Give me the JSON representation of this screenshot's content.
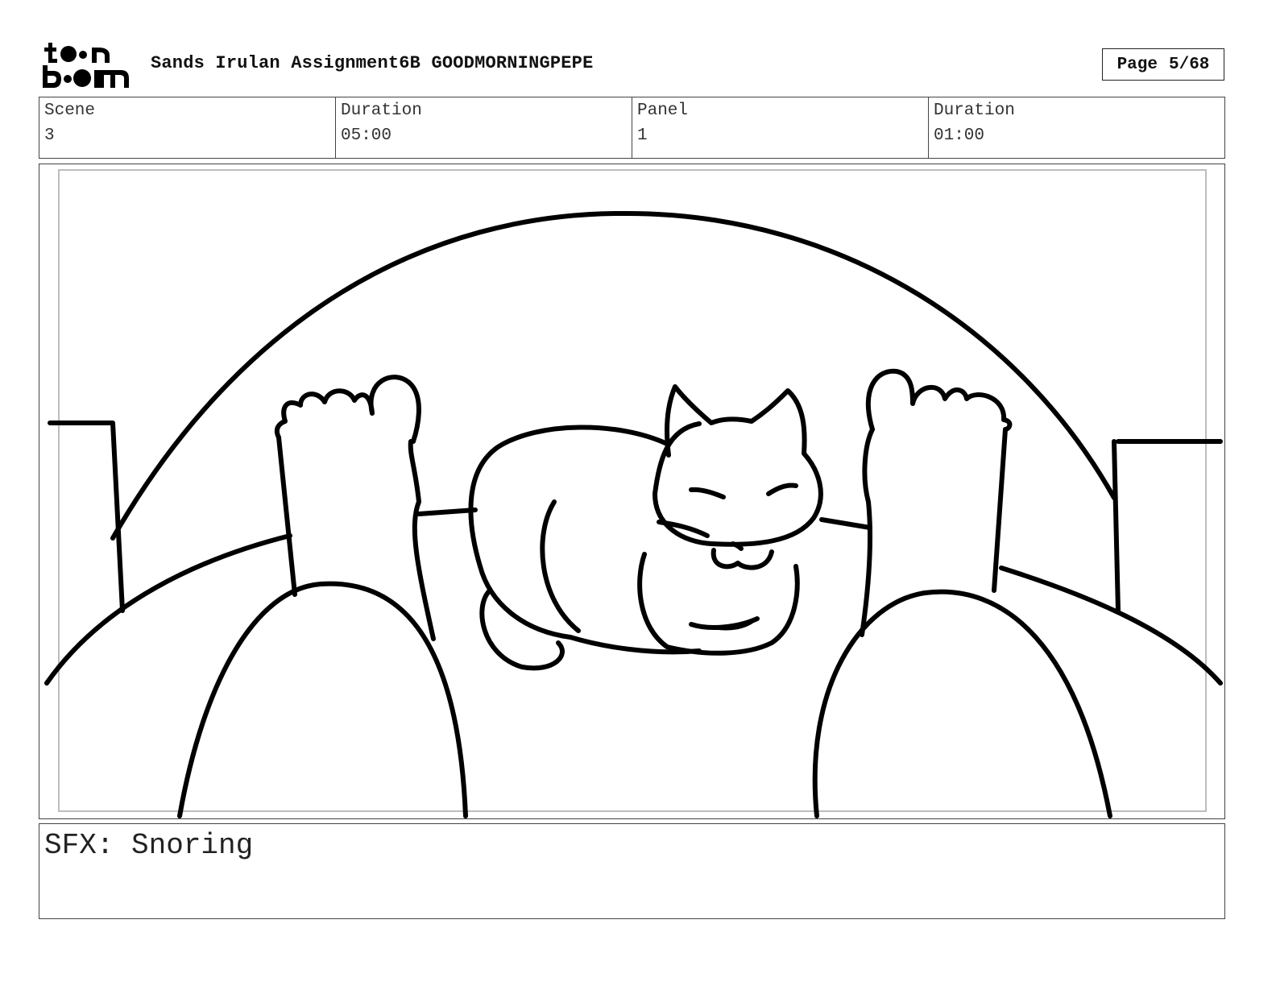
{
  "header": {
    "logo": {
      "line1": "toon",
      "line2": "boom"
    },
    "title": "Sands Irulan Assignment6B GOODMORNINGPEPE",
    "page": {
      "label": "Page",
      "value": "5/68"
    }
  },
  "info": [
    {
      "label": "Scene",
      "value": "3"
    },
    {
      "label": "Duration",
      "value": "05:00"
    },
    {
      "label": "Panel",
      "value": "1"
    },
    {
      "label": "Duration",
      "value": "01:00"
    }
  ],
  "caption": "SFX: Snoring",
  "colors": {
    "ink": "#000000",
    "frame": "#444444",
    "safe_area": "#bdbdbd"
  }
}
